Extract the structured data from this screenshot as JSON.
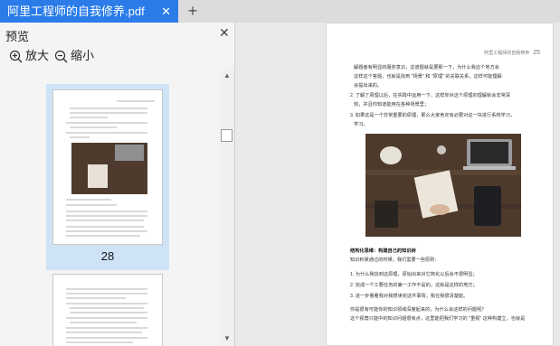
{
  "tab": {
    "title": "阿里工程师的自我修养.pdf",
    "close": "✕"
  },
  "newtab": "+",
  "panel": {
    "title": "预览",
    "close": "✕",
    "zoom_in": "放大",
    "zoom_out": "缩小"
  },
  "thumbs": {
    "current_page": "28"
  },
  "page": {
    "header_title": "阿里工程师的自我修养",
    "header_num": "25",
    "lines": [
      "解题者有明显的服务意识，这道题就是要那一下，为什么我这个地方会",
      "这样这个答题，也就是找到 \"场景\" 和 \"原理\" 的关联关系，这样可能理解",
      "会提出来的。",
      "2. 了解了原理以后，在实践中运用一下，这样你对这个原理的理解就会非常深",
      "刻，并且你知道能用在各种场景里；",
      "3. 如果这是一个非常重要的原理，那么大家肯定有必要对这一块进行系统学习，",
      "学习。"
    ],
    "section_title": "结构化思维：构建自己的知识树",
    "section_sub": "知识积累通过的时候，我们需要一些原则：",
    "list": [
      "1. 为什么我找到这原理，原始出来对它简化以后会不很明显；",
      "2. 完成一个工要任务的第一工作不是的，这就是这样的地方；",
      "3. 进一步看看我对我想读完这件事情；我在我很清楚能。"
    ],
    "tail": [
      "你是很有可能你的知识领域深度起来的，为什么会这样的问题呢？",
      "这个视角只能中的知识问题很有点，这里能把我们学习的 \"重视\" 这种构建立，也就是"
    ]
  }
}
